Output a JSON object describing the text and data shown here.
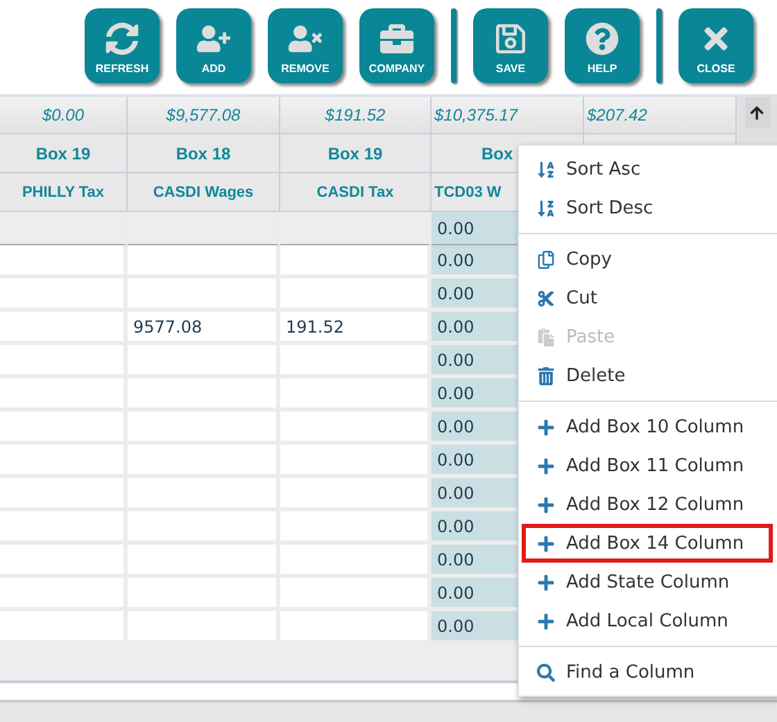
{
  "toolbar": {
    "groups": [
      [
        {
          "label": "REFRESH"
        },
        {
          "label": "ADD"
        },
        {
          "label": "REMOVE"
        },
        {
          "label": "COMPANY"
        }
      ],
      [
        {
          "label": "SAVE"
        },
        {
          "label": "HELP"
        }
      ],
      [
        {
          "label": "CLOSE"
        }
      ]
    ]
  },
  "table": {
    "columns": [
      {
        "total": "$0.00",
        "box": "Box 19",
        "name": "PHILLY Tax",
        "covered": false
      },
      {
        "total": "$9,577.08",
        "box": "Box 18",
        "name": "CASDI Wages",
        "covered": false
      },
      {
        "total": "$191.52",
        "box": "Box 19",
        "name": "CASDI Tax",
        "covered": false
      },
      {
        "total": "$10,375.17",
        "box": "Box",
        "name": "TCD03 W",
        "covered": true
      },
      {
        "total": "$207.42",
        "covered": true
      }
    ],
    "rows": [
      {
        "kind": "filter",
        "column_4": "0.00"
      },
      {
        "kind": "data",
        "column_4": "0.00"
      },
      {
        "kind": "data",
        "column_4": "0.00"
      },
      {
        "kind": "data",
        "column_2": "9577.08",
        "column_3": "191.52",
        "column_4": "0.00"
      },
      {
        "kind": "data",
        "column_4": "0.00"
      },
      {
        "kind": "data",
        "column_4": "0.00"
      },
      {
        "kind": "data",
        "column_4": "0.00"
      },
      {
        "kind": "data",
        "column_4": "0.00"
      },
      {
        "kind": "data",
        "column_4": "0.00"
      },
      {
        "kind": "data",
        "column_4": "0.00"
      },
      {
        "kind": "data",
        "column_4": "0.00"
      },
      {
        "kind": "data",
        "column_4": "0.00"
      },
      {
        "kind": "data",
        "column_4": "0.00"
      }
    ]
  },
  "context_menu": {
    "groups": [
      [
        {
          "label": "Sort Asc",
          "disabled": false,
          "selected": false
        },
        {
          "label": "Sort Desc",
          "disabled": false,
          "selected": false
        }
      ],
      [
        {
          "label": "Copy",
          "disabled": false,
          "selected": false
        },
        {
          "label": "Cut",
          "disabled": false,
          "selected": false
        },
        {
          "label": "Paste",
          "disabled": true,
          "selected": false
        },
        {
          "label": "Delete",
          "disabled": false,
          "selected": false
        }
      ],
      [
        {
          "label": "Add Box 10 Column",
          "disabled": false,
          "selected": false
        },
        {
          "label": "Add Box 11 Column",
          "disabled": false,
          "selected": false
        },
        {
          "label": "Add Box 12 Column",
          "disabled": false,
          "selected": false
        },
        {
          "label": "Add Box 14 Column",
          "disabled": false,
          "selected": true
        },
        {
          "label": "Add State Column",
          "disabled": false,
          "selected": false
        },
        {
          "label": "Add Local Column",
          "disabled": false,
          "selected": false
        }
      ],
      [
        {
          "label": "Find a Column",
          "disabled": false,
          "selected": false
        }
      ]
    ]
  }
}
